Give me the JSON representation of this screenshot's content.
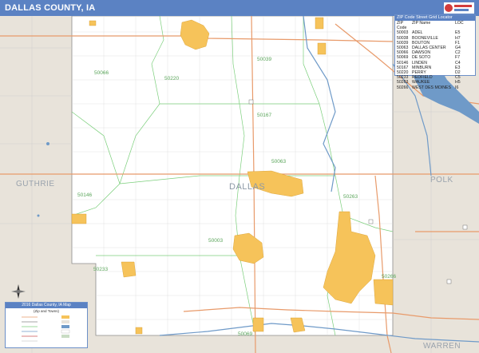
{
  "title": "DALLAS COUNTY, IA",
  "counties": {
    "center": "DALLAS",
    "west": "GUTHRIE",
    "east": "POLK",
    "southeast": "WARREN"
  },
  "zip_labels": [
    {
      "code": "50039",
      "pos": "n"
    },
    {
      "code": "50066",
      "pos": "nw"
    },
    {
      "code": "50220",
      "pos": "n2"
    },
    {
      "code": "50167",
      "pos": "c"
    },
    {
      "code": "50063",
      "pos": "c2"
    },
    {
      "code": "50146",
      "pos": "w"
    },
    {
      "code": "50263",
      "pos": "e"
    },
    {
      "code": "50003",
      "pos": "s"
    },
    {
      "code": "50233",
      "pos": "sw"
    },
    {
      "code": "50266",
      "pos": "se"
    },
    {
      "code": "50069",
      "pos": "s2"
    }
  ],
  "zip_locator": {
    "title": "ZIP Code Street Grid Locator",
    "headers": [
      "ZIP Code",
      "ZIP Name",
      "LOC"
    ],
    "rows": [
      [
        "50003",
        "ADEL",
        "E5"
      ],
      [
        "50038",
        "BOONEVILLE",
        "H7"
      ],
      [
        "50039",
        "BOUTON",
        "F1"
      ],
      [
        "50063",
        "DALLAS CENTER",
        "G4"
      ],
      [
        "50066",
        "DAWSON",
        "C2"
      ],
      [
        "50069",
        "DE SOTO",
        "F7"
      ],
      [
        "50146",
        "LINDEN",
        "C4"
      ],
      [
        "50167",
        "MINBURN",
        "E3"
      ],
      [
        "50220",
        "PERRY",
        "D2"
      ],
      [
        "50233",
        "REDFIELD",
        "C5"
      ],
      [
        "50263",
        "WAUKEE",
        "H5"
      ],
      [
        "50266",
        "WEST DES MOINES",
        "I6"
      ]
    ]
  },
  "legend": {
    "title": "2016 Dallas County, IA Map",
    "subtitle": "(Zip and Towns)"
  },
  "colors": {
    "title_bar": "#5b82c3",
    "town_fill": "#f6c35a",
    "zip_line": "#7ccf7c",
    "highway": "#e89a6a",
    "water": "#6f9ac8",
    "outside_county": "#e8e3da"
  }
}
